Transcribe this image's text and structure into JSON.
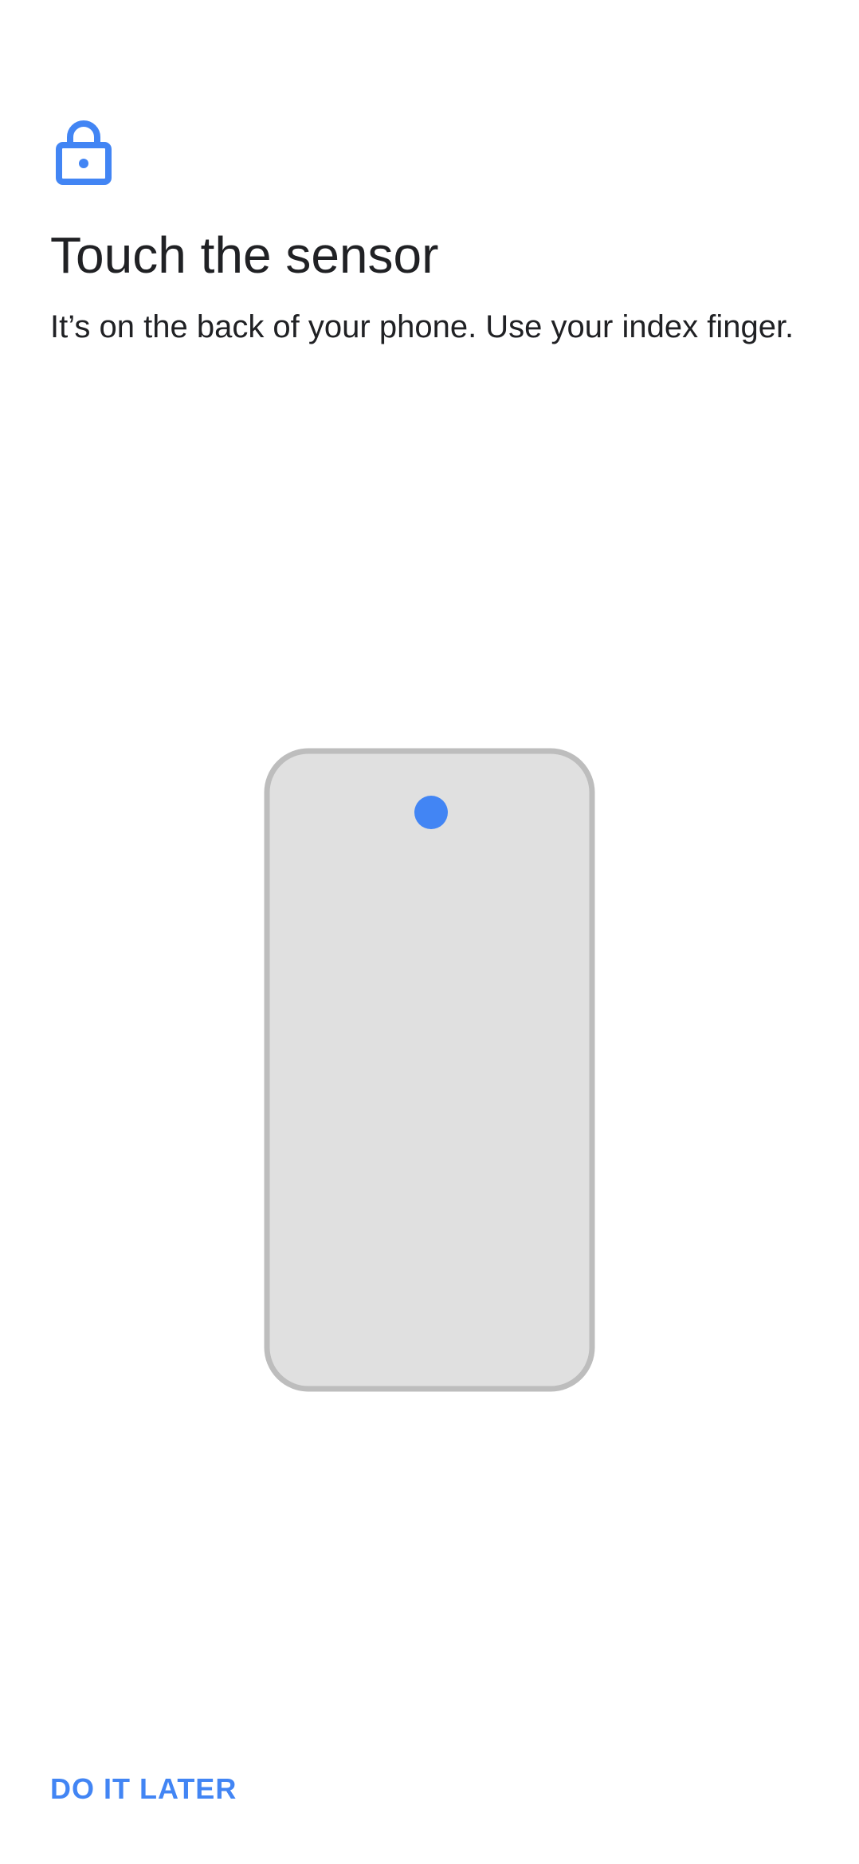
{
  "header": {
    "icon": "lock-icon",
    "title": "Touch the sensor",
    "description": "It’s on the back of your phone. Use your index finger."
  },
  "illustration": {
    "device": "phone-back-icon",
    "sensor": "fingerprint-sensor-dot"
  },
  "footer": {
    "secondary_button_label": "DO IT LATER"
  },
  "colors": {
    "accent": "#4285f4",
    "phone_fill": "#e0e0e0",
    "phone_outline": "#bdbdbd",
    "text": "#202124"
  }
}
